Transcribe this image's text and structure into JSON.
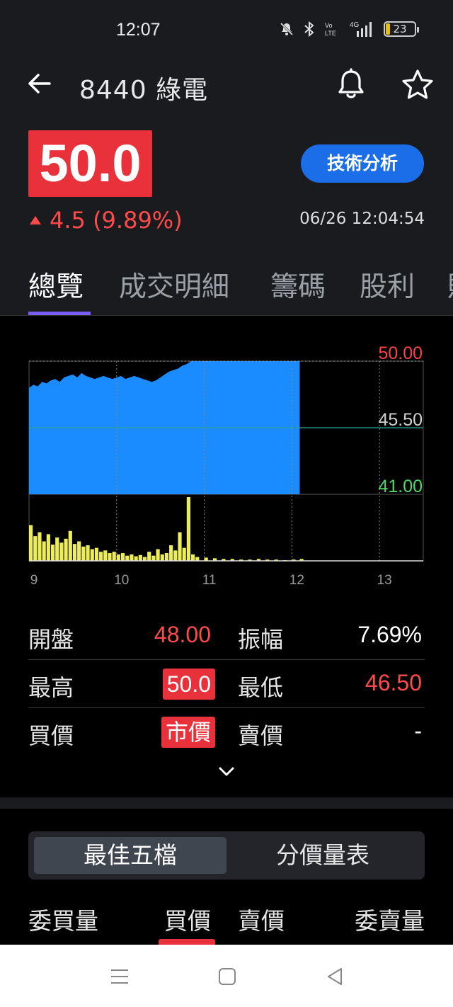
{
  "status_bar": {
    "time": "12:07",
    "battery": "23",
    "icons": [
      "mute-icon",
      "bluetooth-icon",
      "volte-icon",
      "4g-signal-icon",
      "battery-icon"
    ]
  },
  "header": {
    "title": "8440 綠電",
    "price": "50.0",
    "change": "4.5 (9.89%)",
    "timestamp": "06/26 12:04:54",
    "tech_button": "技術分析",
    "colors": {
      "up": "#ff4a4a",
      "price_bg": "#e8313b",
      "button": "#1b6ee8",
      "tab_indicator": "#7b5cf5"
    }
  },
  "tabs": [
    "總覽",
    "成交明細",
    "籌碼",
    "股利",
    "財"
  ],
  "chart_data": {
    "type": "area",
    "x_ticks": [
      "9",
      "10",
      "11",
      "12",
      "13"
    ],
    "y_labels": {
      "high": "50.00",
      "mid": "45.50",
      "low": "41.00"
    },
    "ylim": [
      41.0,
      50.0
    ],
    "reference_price": 45.5,
    "x_range": [
      9.0,
      13.5
    ],
    "price_series": [
      [
        9.0,
        48.2
      ],
      [
        9.05,
        48.4
      ],
      [
        9.1,
        48.3
      ],
      [
        9.15,
        48.6
      ],
      [
        9.2,
        48.5
      ],
      [
        9.25,
        48.7
      ],
      [
        9.3,
        48.8
      ],
      [
        9.35,
        48.6
      ],
      [
        9.4,
        48.9
      ],
      [
        9.45,
        49.0
      ],
      [
        9.5,
        49.1
      ],
      [
        9.55,
        48.9
      ],
      [
        9.6,
        49.2
      ],
      [
        9.65,
        49.0
      ],
      [
        9.7,
        48.9
      ],
      [
        9.75,
        48.8
      ],
      [
        9.8,
        48.9
      ],
      [
        9.85,
        49.0
      ],
      [
        9.9,
        48.9
      ],
      [
        9.95,
        48.8
      ],
      [
        10.0,
        48.9
      ],
      [
        10.05,
        49.0
      ],
      [
        10.1,
        48.8
      ],
      [
        10.15,
        48.9
      ],
      [
        10.2,
        49.0
      ],
      [
        10.25,
        48.9
      ],
      [
        10.3,
        48.8
      ],
      [
        10.35,
        48.7
      ],
      [
        10.4,
        48.6
      ],
      [
        10.45,
        48.7
      ],
      [
        10.5,
        48.9
      ],
      [
        10.55,
        49.1
      ],
      [
        10.6,
        49.3
      ],
      [
        10.65,
        49.4
      ],
      [
        10.7,
        49.5
      ],
      [
        10.75,
        49.7
      ],
      [
        10.8,
        49.8
      ],
      [
        10.85,
        50.0
      ],
      [
        11.0,
        50.0
      ],
      [
        11.5,
        50.0
      ],
      [
        12.0,
        50.0
      ],
      [
        12.09,
        50.0
      ]
    ],
    "volume_series": [
      [
        9.0,
        55
      ],
      [
        9.05,
        38
      ],
      [
        9.1,
        44
      ],
      [
        9.15,
        30
      ],
      [
        9.2,
        41
      ],
      [
        9.25,
        25
      ],
      [
        9.3,
        36
      ],
      [
        9.35,
        28
      ],
      [
        9.4,
        34
      ],
      [
        9.45,
        46
      ],
      [
        9.5,
        26
      ],
      [
        9.55,
        30
      ],
      [
        9.6,
        22
      ],
      [
        9.65,
        24
      ],
      [
        9.7,
        18
      ],
      [
        9.75,
        20
      ],
      [
        9.8,
        14
      ],
      [
        9.85,
        16
      ],
      [
        9.9,
        12
      ],
      [
        9.95,
        14
      ],
      [
        10.0,
        10
      ],
      [
        10.05,
        12
      ],
      [
        10.1,
        8
      ],
      [
        10.15,
        10
      ],
      [
        10.2,
        7
      ],
      [
        10.25,
        9
      ],
      [
        10.3,
        6
      ],
      [
        10.35,
        14
      ],
      [
        10.4,
        8
      ],
      [
        10.45,
        18
      ],
      [
        10.5,
        10
      ],
      [
        10.55,
        12
      ],
      [
        10.6,
        24
      ],
      [
        10.65,
        16
      ],
      [
        10.7,
        44
      ],
      [
        10.75,
        20
      ],
      [
        10.8,
        98
      ],
      [
        10.85,
        10
      ],
      [
        10.9,
        6
      ],
      [
        11.0,
        5
      ],
      [
        11.1,
        4
      ],
      [
        11.2,
        3
      ],
      [
        11.3,
        3
      ],
      [
        11.4,
        2
      ],
      [
        11.5,
        2
      ],
      [
        11.6,
        3
      ],
      [
        11.7,
        2
      ],
      [
        11.8,
        2
      ],
      [
        11.9,
        1
      ],
      [
        12.0,
        2
      ],
      [
        12.09,
        3
      ]
    ],
    "colors": {
      "price_fill": "#1a8cff",
      "volume": "#eded5a",
      "high": "#ff4040",
      "low": "#4cd964",
      "mid": "#cfcfcf",
      "ref_line": "#2aa39a"
    }
  },
  "stats": {
    "open_label": "開盤",
    "open_value": "48.00",
    "amplitude_label": "振幅",
    "amplitude_value": "7.69%",
    "high_label": "最高",
    "high_value": "50.0",
    "low_label": "最低",
    "low_value": "46.50",
    "bid_label": "買價",
    "bid_value": "市價",
    "ask_label": "賣價",
    "ask_value": "-"
  },
  "segment": {
    "best_five": "最佳五檔",
    "price_volume": "分價量表"
  },
  "order_book_header": {
    "bid_vol": "委買量",
    "bid_price": "買價",
    "ask_price": "賣價",
    "ask_vol": "委賣量"
  }
}
